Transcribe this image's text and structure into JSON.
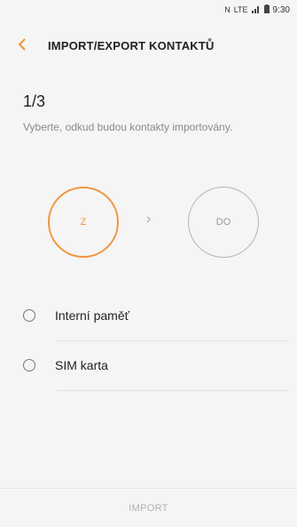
{
  "status_bar": {
    "sim_icon": "N",
    "network": "LTE",
    "time": "9:30"
  },
  "header": {
    "back_icon": "chevron-left-icon",
    "title": "IMPORT/EXPORT KONTAKTŮ"
  },
  "step": {
    "counter": "1/3",
    "description": "Vyberte, odkud budou kontakty importovány."
  },
  "flow": {
    "from_label": "Z",
    "to_label": "DO",
    "arrow": "›"
  },
  "options": [
    {
      "label": "Interní paměť",
      "selected": false
    },
    {
      "label": "SIM karta",
      "selected": false
    }
  ],
  "footer": {
    "import_label": "IMPORT"
  },
  "colors": {
    "accent": "#f0953c",
    "inactive": "#b4b4b4"
  }
}
